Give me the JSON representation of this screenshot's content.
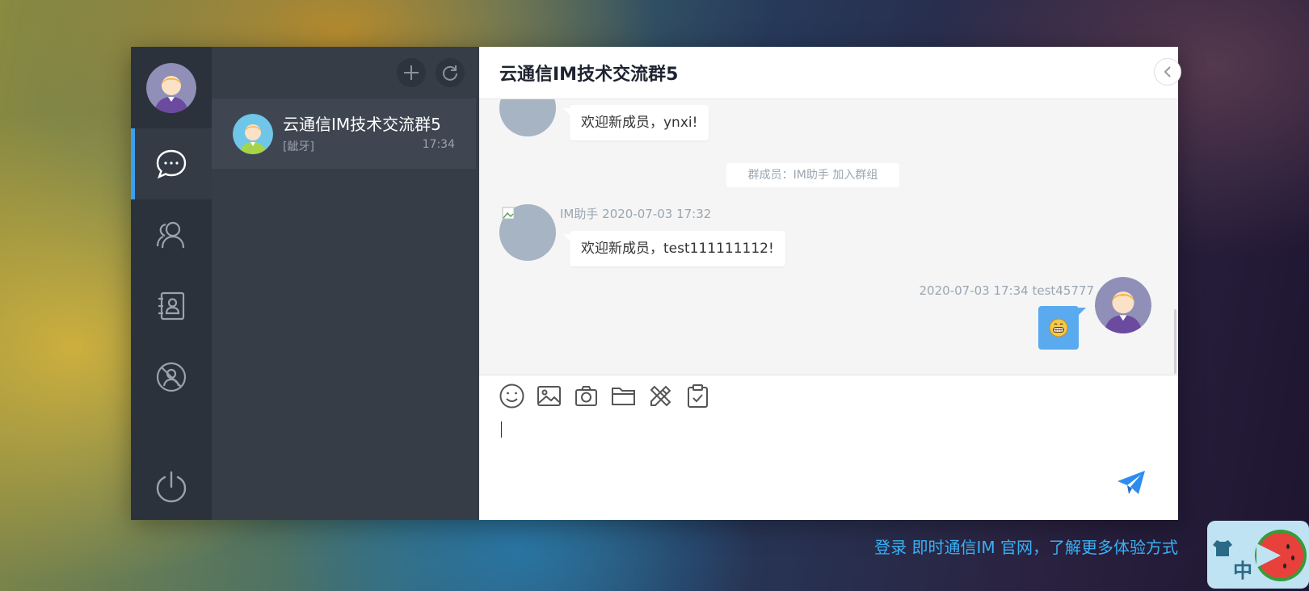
{
  "nav": {
    "items": [
      {
        "name": "chat",
        "icon": "chat-bubble-icon",
        "active": true
      },
      {
        "name": "contacts",
        "icon": "people-icon",
        "active": false
      },
      {
        "name": "address-book",
        "icon": "address-book-icon",
        "active": false
      },
      {
        "name": "blacklist",
        "icon": "blocked-user-icon",
        "active": false
      }
    ],
    "logout_icon": "power-icon"
  },
  "sessions": {
    "toolbar": {
      "add_icon": "plus-icon",
      "refresh_icon": "refresh-icon"
    },
    "items": [
      {
        "name": "云通信IM技术交流群5",
        "last_message": "[龇牙]",
        "time": "17:34",
        "active": true
      }
    ]
  },
  "chat": {
    "title": "云通信IM技术交流群5",
    "messages": [
      {
        "type": "text",
        "text": "欢迎新成员，ynxi!"
      },
      {
        "type": "system",
        "text": "群成员：IM助手 加入群组"
      },
      {
        "type": "text",
        "sender": "IM助手",
        "time": "2020-07-03 17:32",
        "text": "欢迎新成员，test111111112!"
      },
      {
        "type": "emoji",
        "sender": "test45777",
        "time": "2020-07-03 17:34",
        "emoji": "grin-emoji",
        "self": true
      }
    ],
    "toolbar_icons": [
      "emoji-icon",
      "image-icon",
      "camera-icon",
      "folder-icon",
      "custom-message-icon",
      "survey-icon"
    ],
    "input_value": "",
    "send_icon": "send-icon"
  },
  "footer": {
    "link_text": "登录 即时通信IM 官网，了解更多体验方式",
    "widget_char": "中"
  },
  "colors": {
    "accent": "#3aa1f2",
    "nav_bg": "#2c323b",
    "session_bg": "#363d47",
    "bubble_self": "#5aaaf0"
  }
}
